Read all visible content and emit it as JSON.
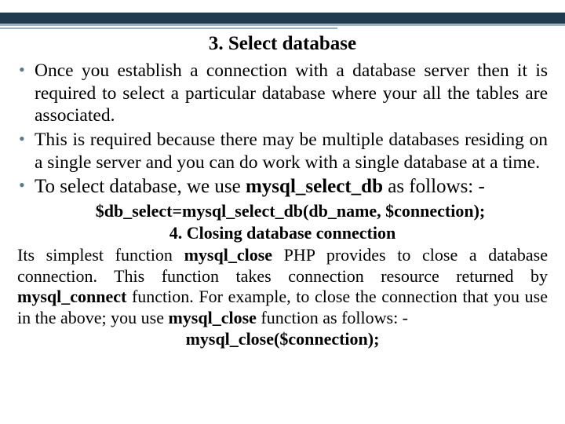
{
  "title": "3. Select database",
  "bullet1": "Once you establish a connection with a database server then it is required to select a particular database where your all the tables are associated.",
  "bullet2": "This is required because there may be multiple databases residing on a single server and you can do work with a single database at a time.",
  "bullet3_pre": "To select database, we use ",
  "bullet3_fn": "mysql_select_db",
  "bullet3_post": " as follows: -",
  "code1": "$db_select=mysql_select_db(db_name, $connection);",
  "subtitle": "4. Closing database connection",
  "para_1": "Its simplest function ",
  "para_fn1": "mysql_close",
  "para_2": " PHP provides to close a database connection. This function takes connection resource returned by ",
  "para_fn2": "mysql_connect",
  "para_3": " function. For example, to close the connection that you use in the above; you use ",
  "para_fn3": "mysql_close",
  "para_4": " function as follows: -",
  "code2": "mysql_close($connection);"
}
